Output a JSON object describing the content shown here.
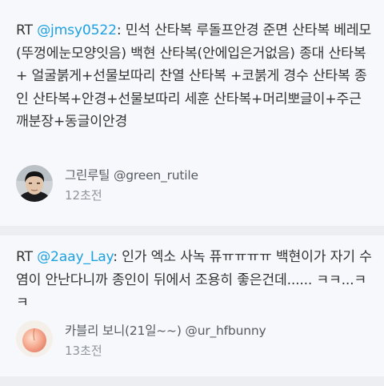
{
  "tweets": [
    {
      "rt": "RT ",
      "mention": "@jmsy0522",
      "text": ": 민석 산타복 루돌프안경 준면 산타복 베레모(뚜껑에눈모양잇음) 백현 산타복(안에입은거없음) 종대 산타복 + 얼굴붉게+선물보따리 찬열 산타복 +코붉게 경수 산타복 종인 산타복+안경+선물보따리 세훈 산타복+머리뽀글이+주근깨분장+동글이안경",
      "author": "그린루틸 @green_rutile",
      "time": "12초전",
      "avatar": "person-avatar"
    },
    {
      "rt": "RT ",
      "mention": "@2aay_Lay",
      "text": ": 인가 엑소 사녹 퓨ㅠㅠㅠㅠ 백현이가 자기 수염이 안난다니까 종인이 뒤에서 조용히 좋은건데...... ㅋㅋ...ㅋㅋ",
      "author": "카블리 보니(21일~~) @ur_hfbunny",
      "time": "13초전",
      "avatar": "peach-avatar"
    }
  ],
  "colors": {
    "mention": "#1da1e2",
    "text": "#333333",
    "card": "#f7f8fb",
    "background": "#eceef2"
  }
}
